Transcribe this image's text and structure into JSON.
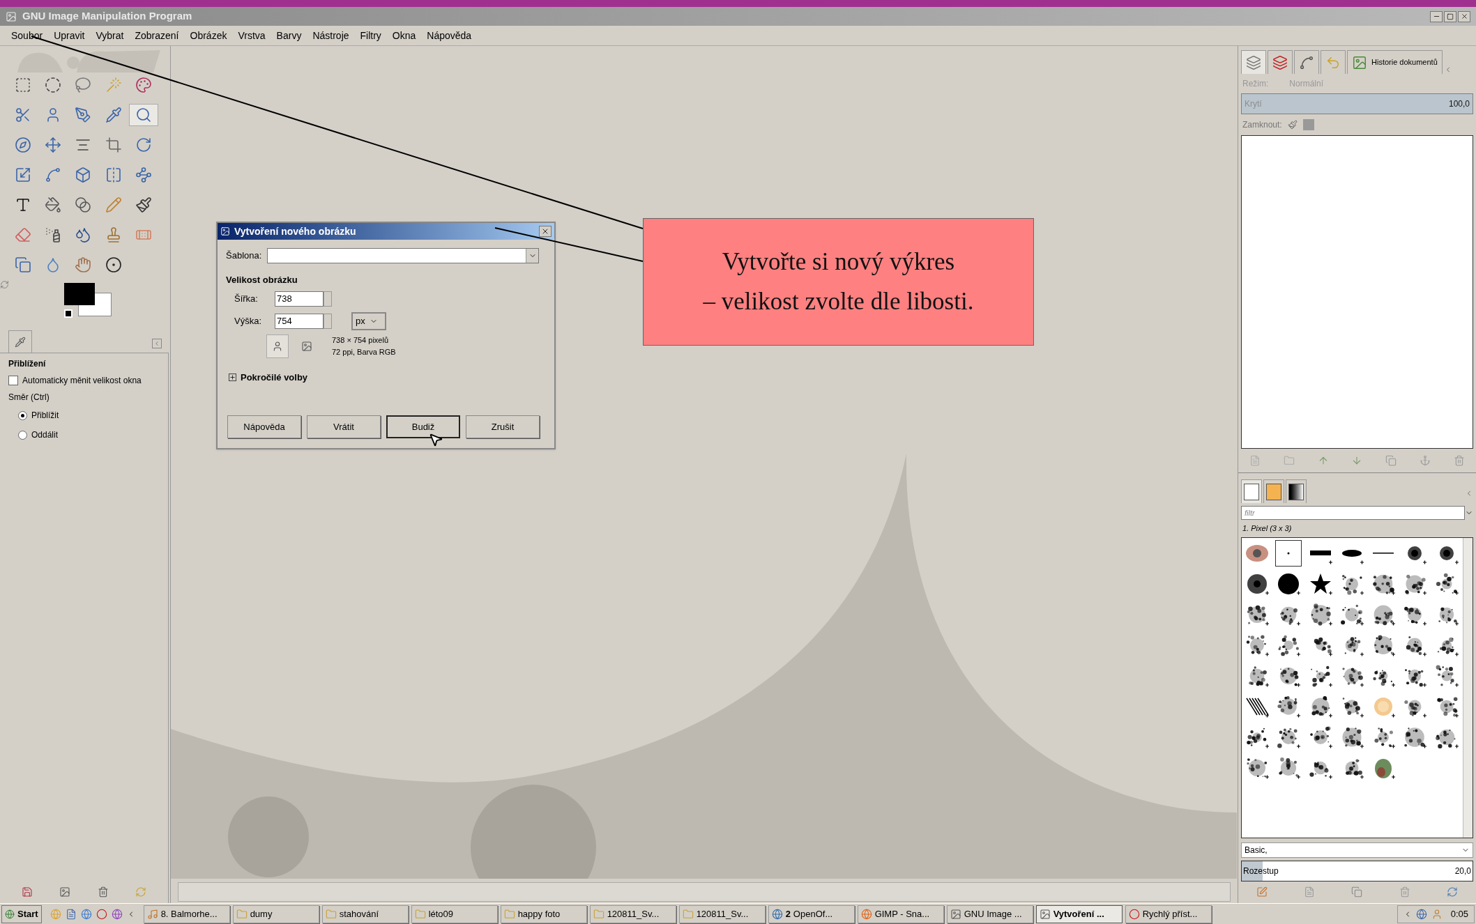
{
  "window": {
    "title": "GNU Image Manipulation Program"
  },
  "menu": [
    "Soubor",
    "Upravit",
    "Vybrat",
    "Zobrazení",
    "Obrázek",
    "Vrstva",
    "Barvy",
    "Nástroje",
    "Filtry",
    "Okna",
    "Nápověda"
  ],
  "toolbox": {
    "tools": [
      {
        "selected": false
      },
      {
        "selected": false
      },
      {
        "selected": false
      },
      {
        "selected": false
      },
      {
        "selected": false
      },
      {
        "selected": false
      },
      {
        "selected": false
      },
      {
        "selected": false
      },
      {
        "selected": false
      },
      {
        "selected": true
      },
      {
        "selected": false
      },
      {
        "selected": false
      },
      {
        "selected": false
      },
      {
        "selected": false
      },
      {
        "selected": false
      },
      {
        "selected": false
      },
      {
        "selected": false
      },
      {
        "selected": false
      },
      {
        "selected": false
      },
      {
        "selected": false
      },
      {
        "selected": false
      },
      {
        "selected": false
      },
      {
        "selected": false
      },
      {
        "selected": false
      },
      {
        "selected": false
      },
      {
        "selected": false
      },
      {
        "selected": false
      },
      {
        "selected": false
      },
      {
        "selected": false
      },
      {
        "selected": false
      },
      {
        "selected": false
      },
      {
        "selected": false
      },
      {
        "selected": false
      },
      {
        "selected": false
      }
    ],
    "tool_options": {
      "title": "Přiblížení",
      "checkbox": {
        "label": "Automaticky měnit velikost okna",
        "checked": false
      },
      "direction_label": "Směr (Ctrl)",
      "radios": [
        {
          "label": "Přiblížit",
          "selected": true
        },
        {
          "label": "Oddálit",
          "selected": false
        }
      ]
    }
  },
  "dialog": {
    "title": "Vytvoření nového obrázku",
    "template_label": "Šablona:",
    "size_heading": "Velikost obrázku",
    "width_label": "Šířka:",
    "width_value": "738",
    "height_label": "Výška:",
    "height_value": "754",
    "unit": "px",
    "orientation": [
      {
        "selected": true
      },
      {
        "selected": false
      }
    ],
    "info": [
      "738 × 754 pixelů",
      "72 ppi, Barva RGB"
    ],
    "advanced": "Pokročilé volby",
    "buttons": [
      {
        "label": "Nápověda",
        "default": false
      },
      {
        "label": "Vrátit",
        "default": false
      },
      {
        "label": "Budiž",
        "default": true
      },
      {
        "label": "Zrušit",
        "default": false
      }
    ]
  },
  "callout": {
    "lines": [
      "Vytvořte si nový výkres",
      "– velikost zvolte dle libosti."
    ]
  },
  "layers_dock": {
    "tabs": [
      {
        "selected": true
      },
      {
        "selected": false
      },
      {
        "selected": false
      },
      {
        "selected": false
      },
      {
        "label": "Historie dokumentů",
        "selected": false
      }
    ],
    "mode_label": "Režim:",
    "mode_value": "Normální",
    "disabled": true,
    "opacity": {
      "label": "Krytí",
      "value": "100,0",
      "level": 1
    },
    "lock_label": "Zamknout:"
  },
  "brushes_dock": {
    "tabs": [
      {
        "selected": true
      },
      {
        "selected": false
      },
      {
        "selected": false
      }
    ],
    "filter_placeholder": "filtr",
    "brush_name": "1. Pixel (3 x 3)",
    "brushes": [
      {
        "selected": false
      },
      {
        "selected": true
      },
      {
        "selected": false
      },
      {
        "selected": false
      },
      {
        "selected": false
      },
      {
        "selected": false
      },
      {
        "selected": false
      },
      {
        "selected": false
      },
      {
        "selected": false
      },
      {
        "selected": false
      },
      {
        "selected": false
      },
      {
        "selected": false
      },
      {
        "selected": false
      },
      {
        "selected": false
      },
      {
        "selected": false
      },
      {
        "selected": false
      },
      {
        "selected": false
      },
      {
        "selected": false
      },
      {
        "selected": false
      },
      {
        "selected": false
      },
      {
        "selected": false
      },
      {
        "selected": false
      },
      {
        "selected": false
      },
      {
        "selected": false
      },
      {
        "selected": false
      },
      {
        "selected": false
      },
      {
        "selected": false
      },
      {
        "selected": false
      },
      {
        "selected": false
      },
      {
        "selected": false
      },
      {
        "selected": false
      },
      {
        "selected": false
      },
      {
        "selected": false
      },
      {
        "selected": false
      },
      {
        "selected": false
      },
      {
        "selected": false
      },
      {
        "selected": false
      },
      {
        "selected": false
      },
      {
        "selected": false
      },
      {
        "selected": false
      },
      {
        "selected": false
      },
      {
        "selected": false
      },
      {
        "selected": false
      },
      {
        "selected": false
      },
      {
        "selected": false
      },
      {
        "selected": false
      },
      {
        "selected": false
      },
      {
        "selected": false
      },
      {
        "selected": false
      },
      {
        "selected": false
      },
      {
        "selected": false
      },
      {
        "selected": false
      },
      {
        "selected": false
      },
      {
        "selected": false
      }
    ],
    "tag": "Basic,",
    "spacing": {
      "label": "Rozestup",
      "value": "20,0",
      "level": 0.09
    }
  },
  "taskbar": {
    "start": "Start",
    "tasks": [
      {
        "label": "8. Balmorhe...",
        "kind": "media",
        "selected": false
      },
      {
        "label": "dumy",
        "kind": "folder",
        "selected": false
      },
      {
        "label": "stahování",
        "kind": "folder",
        "selected": false
      },
      {
        "label": "léto09",
        "kind": "folder",
        "selected": false
      },
      {
        "label": "happy foto",
        "kind": "folder",
        "selected": false
      },
      {
        "label": "120811_Sv...",
        "kind": "folder",
        "selected": false
      },
      {
        "label": "120811_Sv...",
        "kind": "folder",
        "selected": false
      },
      {
        "label": "OpenOf...",
        "count": "2",
        "kind": "office",
        "selected": false
      },
      {
        "label": "GIMP - Sna...",
        "kind": "browser",
        "selected": false
      },
      {
        "label": "GNU Image ...",
        "kind": "gimp",
        "selected": false
      },
      {
        "label": "Vytvoření ...",
        "kind": "gimp",
        "selected": true
      },
      {
        "label": "Rychlý příst...",
        "kind": "opera",
        "selected": false
      }
    ],
    "clock": "0:05"
  }
}
